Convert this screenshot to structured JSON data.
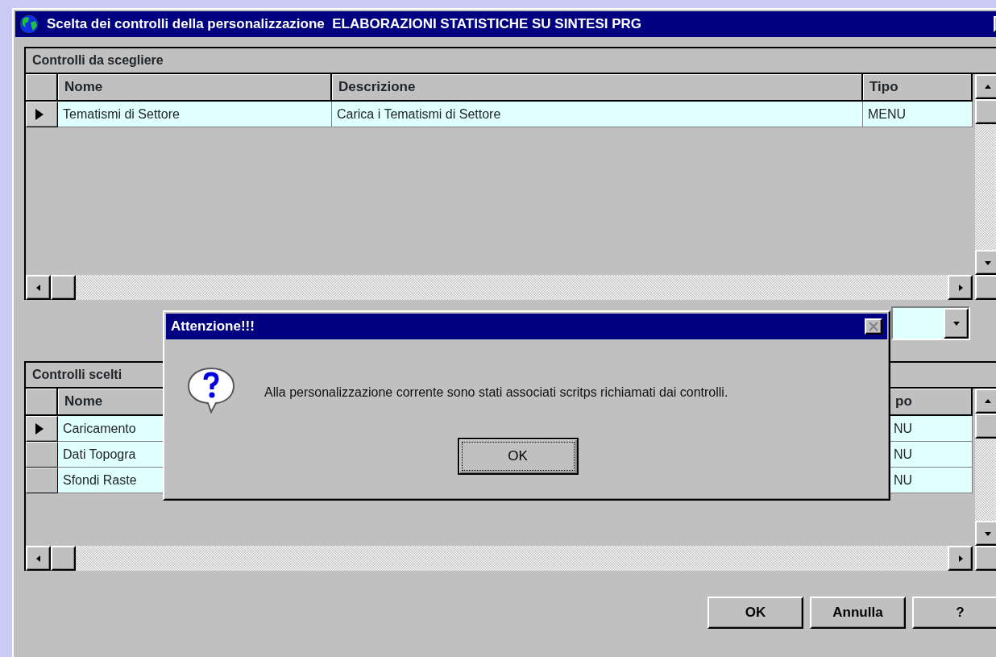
{
  "window": {
    "title": "Scelta dei controlli della personalizzazione  ELABORAZIONI STATISTICHE SU SINTESI PRG"
  },
  "available_controls": {
    "caption": "Controlli da scegliere",
    "columns": {
      "name": "Nome",
      "description": "Descrizione",
      "type": "Tipo"
    },
    "rows": [
      {
        "selected": true,
        "name": "Tematismi di Settore",
        "description": "Carica i Tematismi di Settore",
        "type": "MENU"
      }
    ]
  },
  "chosen_controls": {
    "caption": "Controlli scelti",
    "columns": {
      "name": "Nome",
      "type": "po"
    },
    "rows": [
      {
        "selected": true,
        "name": "Caricamento",
        "type": "NU"
      },
      {
        "selected": false,
        "name": "Dati Topogra",
        "type": "NU"
      },
      {
        "selected": false,
        "name": "Sfondi Raste",
        "type": "NU"
      }
    ]
  },
  "buttons": [
    "OK",
    "Annulla",
    "?"
  ],
  "dialog": {
    "title": "Attenzione!!!",
    "message": "Alla personalizzazione corrente sono stati associati scritps richiamati dai controlli.",
    "buttons": [
      {
        "label": "OK",
        "focused": true
      }
    ]
  }
}
